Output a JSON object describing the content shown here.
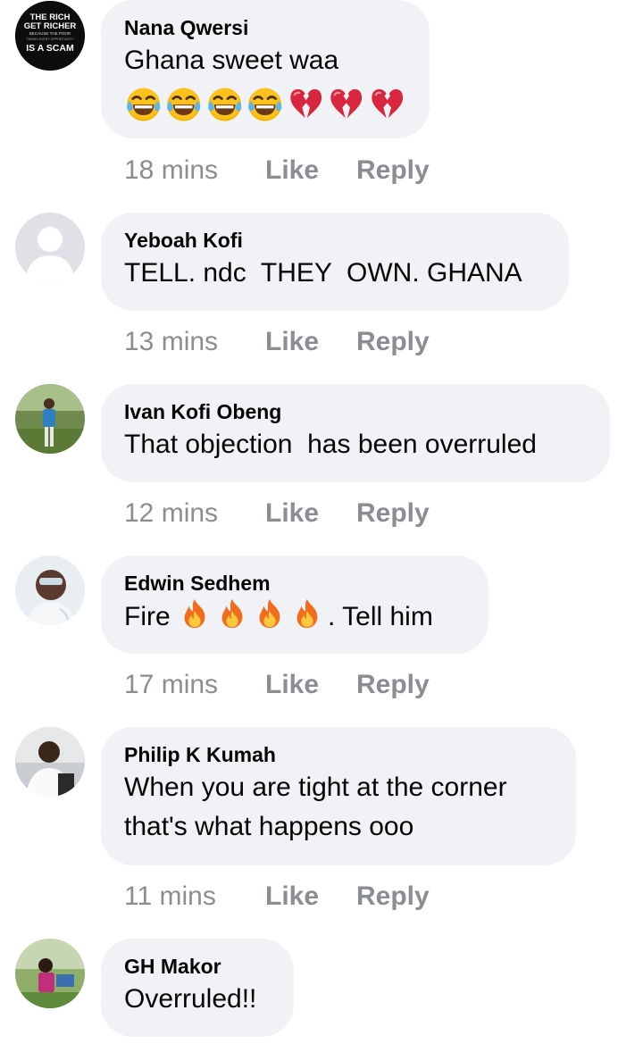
{
  "comments": [
    {
      "author": "Nana Qwersi",
      "text": "Ghana sweet waa",
      "emojis": [
        "laughing-tears",
        "laughing-tears",
        "laughing-tears",
        "laughing-tears",
        "broken-heart",
        "broken-heart",
        "broken-heart"
      ],
      "time": "18 mins",
      "avatar_text": [
        "THE RICH",
        "GET RICHER",
        "BECAUSE THE POOR",
        "THINKS EVERY OPPORTUNITY",
        "IS A SCAM"
      ]
    },
    {
      "author": "Yeboah Kofi",
      "text": "TELL. ndc  THEY  OWN. GHANA",
      "time": "13 mins"
    },
    {
      "author": "Ivan Kofi Obeng",
      "text": "That objection  has been overruled",
      "time": "12 mins"
    },
    {
      "author": "Edwin Sedhem",
      "text_before": "Fire ",
      "text_after": ". Tell him",
      "emojis": [
        "fire",
        "fire",
        "fire",
        "fire"
      ],
      "time": "17 mins"
    },
    {
      "author": "Philip K Kumah",
      "text_line1": "When you are tight at the corner",
      "text_line2": "that's what happens ooo",
      "time": "11 mins"
    },
    {
      "author": "GH Makor",
      "text": "Overruled!!"
    }
  ],
  "actions": {
    "like_label": "Like",
    "reply_label": "Reply"
  },
  "colors": {
    "bubble": "#f0f2f5",
    "meta": "#8a8d91",
    "text": "#050505"
  }
}
